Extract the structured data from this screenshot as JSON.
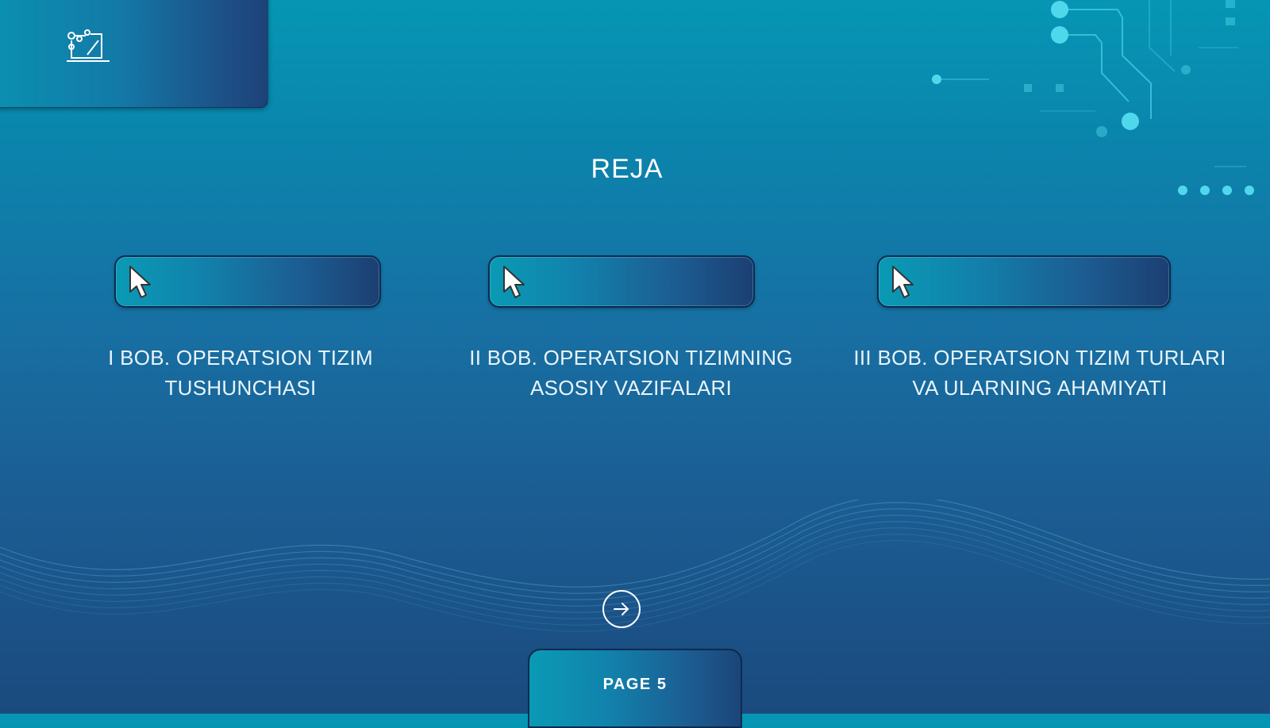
{
  "slide": {
    "title": "REJA",
    "chapters": [
      {
        "line1": "I BOB. OPERATSION TIZIM",
        "line2": "TUSHUNCHASI"
      },
      {
        "line1": "II BOB. OPERATSION TIZIMNING",
        "line2": "ASOSIY VAZIFALARI"
      },
      {
        "line1": "III BOB. OPERATSION TIZIM TURLARI",
        "line2": "VA ULARNING AHAMIYATI"
      }
    ],
    "page_label": "PAGE 5"
  },
  "icons": {
    "logo": "laptop-network-icon",
    "pill_cursor": "mouse-pointer-icon",
    "next": "arrow-right-circle-icon"
  },
  "colors": {
    "background_top": "#0696b4",
    "background_bottom": "#1b4a7e",
    "accent_cyan": "#4fd8ec",
    "text": "#ffffff"
  }
}
